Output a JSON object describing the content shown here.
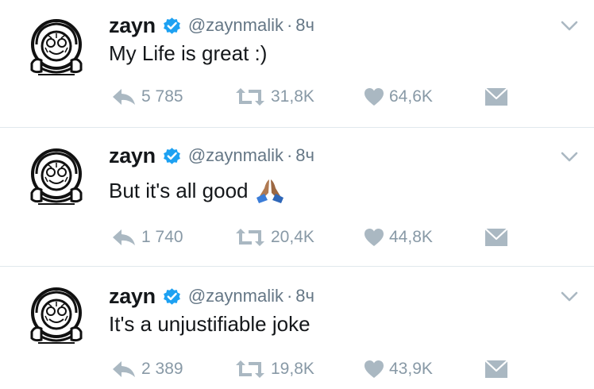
{
  "colors": {
    "text_primary": "#14171a",
    "text_secondary": "#657786",
    "action_gray": "#aab8c2",
    "verified_blue": "#1da1f2",
    "divider": "#e1e8ed"
  },
  "tweets": [
    {
      "name": "zayn",
      "handle": "@zaynmalik",
      "separator": "·",
      "time": "8ч",
      "text": "My Life is great :)",
      "has_emoji": false,
      "replies": "5 785",
      "retweets": "31,8K",
      "likes": "64,6K"
    },
    {
      "name": "zayn",
      "handle": "@zaynmalik",
      "separator": "·",
      "time": "8ч",
      "text": "But it's all good",
      "has_emoji": true,
      "emoji": "folded-hands-emoji",
      "replies": "1 740",
      "retweets": "20,4K",
      "likes": "44,8K"
    },
    {
      "name": "zayn",
      "handle": "@zaynmalik",
      "separator": "·",
      "time": "8ч",
      "text": "It's a unjustifiable joke",
      "has_emoji": false,
      "replies": "2 389",
      "retweets": "19,8K",
      "likes": "43,9K"
    }
  ],
  "icons": {
    "avatar": "astronaut-helmet-avatar",
    "verified": "verified-badge-icon",
    "caret": "chevron-down-icon",
    "reply": "reply-icon",
    "retweet": "retweet-icon",
    "like": "heart-icon",
    "dm": "direct-message-icon"
  }
}
